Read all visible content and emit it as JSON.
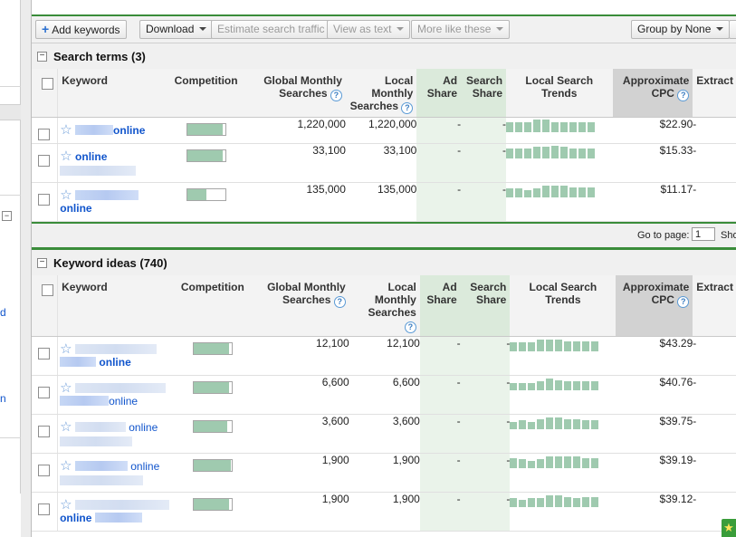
{
  "toolbar": {
    "add_keywords": "Add keywords",
    "download": "Download",
    "estimate": "Estimate search traffic",
    "view_as_text": "View as text",
    "more_like_these": "More like these",
    "group_by": "Group by None"
  },
  "columns": {
    "keyword": "Keyword",
    "competition": "Competition",
    "global_monthly": "Global Monthly Searches",
    "local_monthly": "Local Monthly Searches",
    "ad_share": "Ad Share",
    "search_share": "Search Share",
    "local_trends": "Local Search Trends",
    "approx_cpc": "Approximate CPC",
    "extract": "Extract"
  },
  "search_terms": {
    "title": "Search terms (3)",
    "rows": [
      {
        "keyword": "online",
        "competition": 0.93,
        "global": "1,220,000",
        "local": "1,220,000",
        "ad_share": "-",
        "search_share": "-",
        "trend": [
          7,
          7,
          7,
          9,
          9,
          7,
          7,
          7,
          7,
          7
        ],
        "cpc": "$22.90",
        "extract": "-"
      },
      {
        "keyword": "online",
        "competition": 0.93,
        "global": "33,100",
        "local": "33,100",
        "ad_share": "-",
        "search_share": "-",
        "trend": [
          7,
          7,
          7,
          8,
          8,
          9,
          8,
          7,
          7,
          7
        ],
        "cpc": "$15.33",
        "extract": "-"
      },
      {
        "keyword": "online",
        "competition": 0.5,
        "global": "135,000",
        "local": "135,000",
        "ad_share": "-",
        "search_share": "-",
        "trend": [
          6,
          6,
          5,
          6,
          8,
          8,
          8,
          7,
          7,
          7
        ],
        "cpc": "$11.17",
        "extract": "-"
      }
    ]
  },
  "pager": {
    "go_to_page": "Go to page:",
    "page": "1",
    "show": "Sho"
  },
  "keyword_ideas": {
    "title": "Keyword ideas (740)",
    "rows": [
      {
        "keyword": "online",
        "competition": 0.93,
        "global": "12,100",
        "local": "12,100",
        "ad_share": "-",
        "search_share": "-",
        "trend": [
          6,
          6,
          6,
          8,
          8,
          8,
          7,
          7,
          7,
          7
        ],
        "cpc": "$43.29",
        "extract": "-"
      },
      {
        "keyword": "online",
        "competition": 0.93,
        "global": "6,600",
        "local": "6,600",
        "ad_share": "-",
        "search_share": "-",
        "trend": [
          5,
          5,
          5,
          6,
          8,
          7,
          6,
          6,
          6,
          6
        ],
        "cpc": "$40.76",
        "extract": "-"
      },
      {
        "keyword": "online",
        "competition": 0.88,
        "global": "3,600",
        "local": "3,600",
        "ad_share": "-",
        "search_share": "-",
        "trend": [
          5,
          6,
          5,
          7,
          8,
          8,
          7,
          7,
          6,
          6
        ],
        "cpc": "$39.75",
        "extract": "-"
      },
      {
        "keyword": "online",
        "competition": 0.98,
        "global": "1,900",
        "local": "1,900",
        "ad_share": "-",
        "search_share": "-",
        "trend": [
          7,
          6,
          5,
          6,
          8,
          8,
          8,
          8,
          7,
          7
        ],
        "cpc": "$39.19",
        "extract": "-"
      },
      {
        "keyword": "online",
        "competition": 0.93,
        "global": "1,900",
        "local": "1,900",
        "ad_share": "-",
        "search_share": "-",
        "trend": [
          6,
          5,
          6,
          6,
          8,
          8,
          7,
          6,
          7,
          7
        ],
        "cpc": "$39.12",
        "extract": "-"
      }
    ]
  },
  "colors": {
    "accent_green": "#3a8c3a",
    "link_blue": "#1155cc",
    "bar_green": "#9fcaaf"
  }
}
